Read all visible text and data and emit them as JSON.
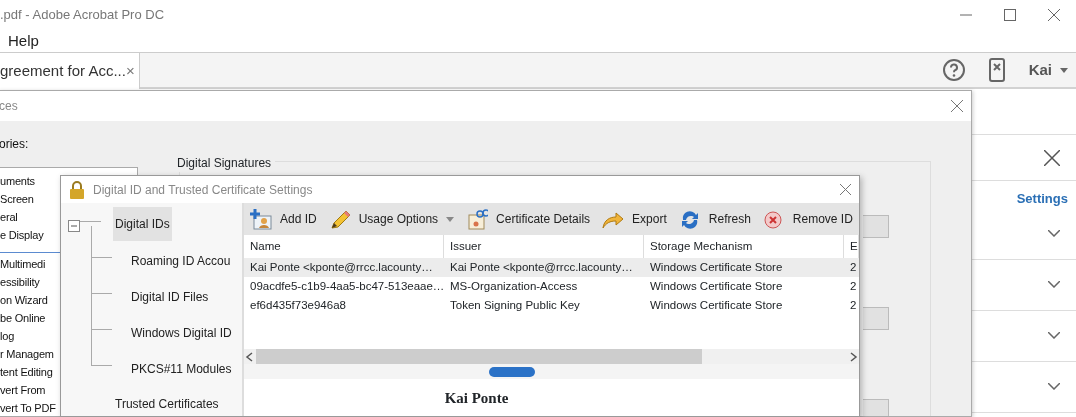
{
  "app": {
    "title": ".pdf - Adobe Acrobat Pro DC",
    "menu": [
      "Help"
    ],
    "tab": {
      "label": "greement for Acc...",
      "close": "×"
    },
    "user": "Kai"
  },
  "side_panel": {
    "link": "Settings",
    "sections": [
      {
        "expanded": false
      },
      {
        "expanded": false
      },
      {
        "expanded": false
      },
      {
        "expanded": false
      }
    ]
  },
  "preferences": {
    "title": "ces",
    "categories_label": "ories:",
    "categories": [
      {
        "label": "uments"
      },
      {
        "label": "Screen"
      },
      {
        "label": "eral"
      },
      {
        "label": "e Display"
      },
      {
        "label": "Multimedi"
      },
      {
        "label": "essibility"
      },
      {
        "label": "on Wizard"
      },
      {
        "label": "be Online"
      },
      {
        "label": "log"
      },
      {
        "label": "r Managem"
      },
      {
        "label": "tent Editing"
      },
      {
        "label": "vert From"
      },
      {
        "label": "vert To PDF"
      }
    ],
    "group_title": "Digital Signatures"
  },
  "digital_id_dialog": {
    "title": "Digital ID and Trusted Certificate Settings",
    "tree": [
      {
        "label": "Digital IDs",
        "selected": true,
        "expanded": true,
        "children": [
          {
            "label": "Roaming ID Accou",
            "selected": false
          },
          {
            "label": "Digital ID Files",
            "selected": false
          },
          {
            "label": "Windows Digital ID",
            "selected": false
          },
          {
            "label": "PKCS#11 Modules",
            "selected": false
          }
        ]
      },
      {
        "label": "Trusted Certificates",
        "selected": false
      }
    ],
    "toolbar": [
      {
        "label": "Add ID",
        "kind": "add"
      },
      {
        "label": "Usage Options",
        "kind": "pencil",
        "dropdown": true
      },
      {
        "label": "Certificate Details",
        "kind": "certificate"
      },
      {
        "label": "Export",
        "kind": "export"
      },
      {
        "label": "Refresh",
        "kind": "refresh"
      },
      {
        "label": "Remove ID",
        "kind": "remove"
      }
    ],
    "table": {
      "columns": [
        "Name",
        "Issuer",
        "Storage Mechanism",
        "E"
      ],
      "rows": [
        {
          "selected": true,
          "cells": [
            "Kai Ponte <kponte@rrcc.lacounty…",
            "Kai Ponte <kponte@rrcc.lacounty…",
            "Windows Certificate Store",
            "2"
          ]
        },
        {
          "selected": false,
          "cells": [
            "09acdfe5-c1b9-4aa5-bc47-513eaae…",
            "MS-Organization-Access",
            "Windows Certificate Store",
            "2"
          ]
        },
        {
          "selected": false,
          "cells": [
            "ef6d435f73e946a8",
            "Token Signing Public Key",
            "Windows Certificate Store",
            "2"
          ]
        }
      ]
    },
    "detail": {
      "name": "Kai Ponte"
    }
  }
}
